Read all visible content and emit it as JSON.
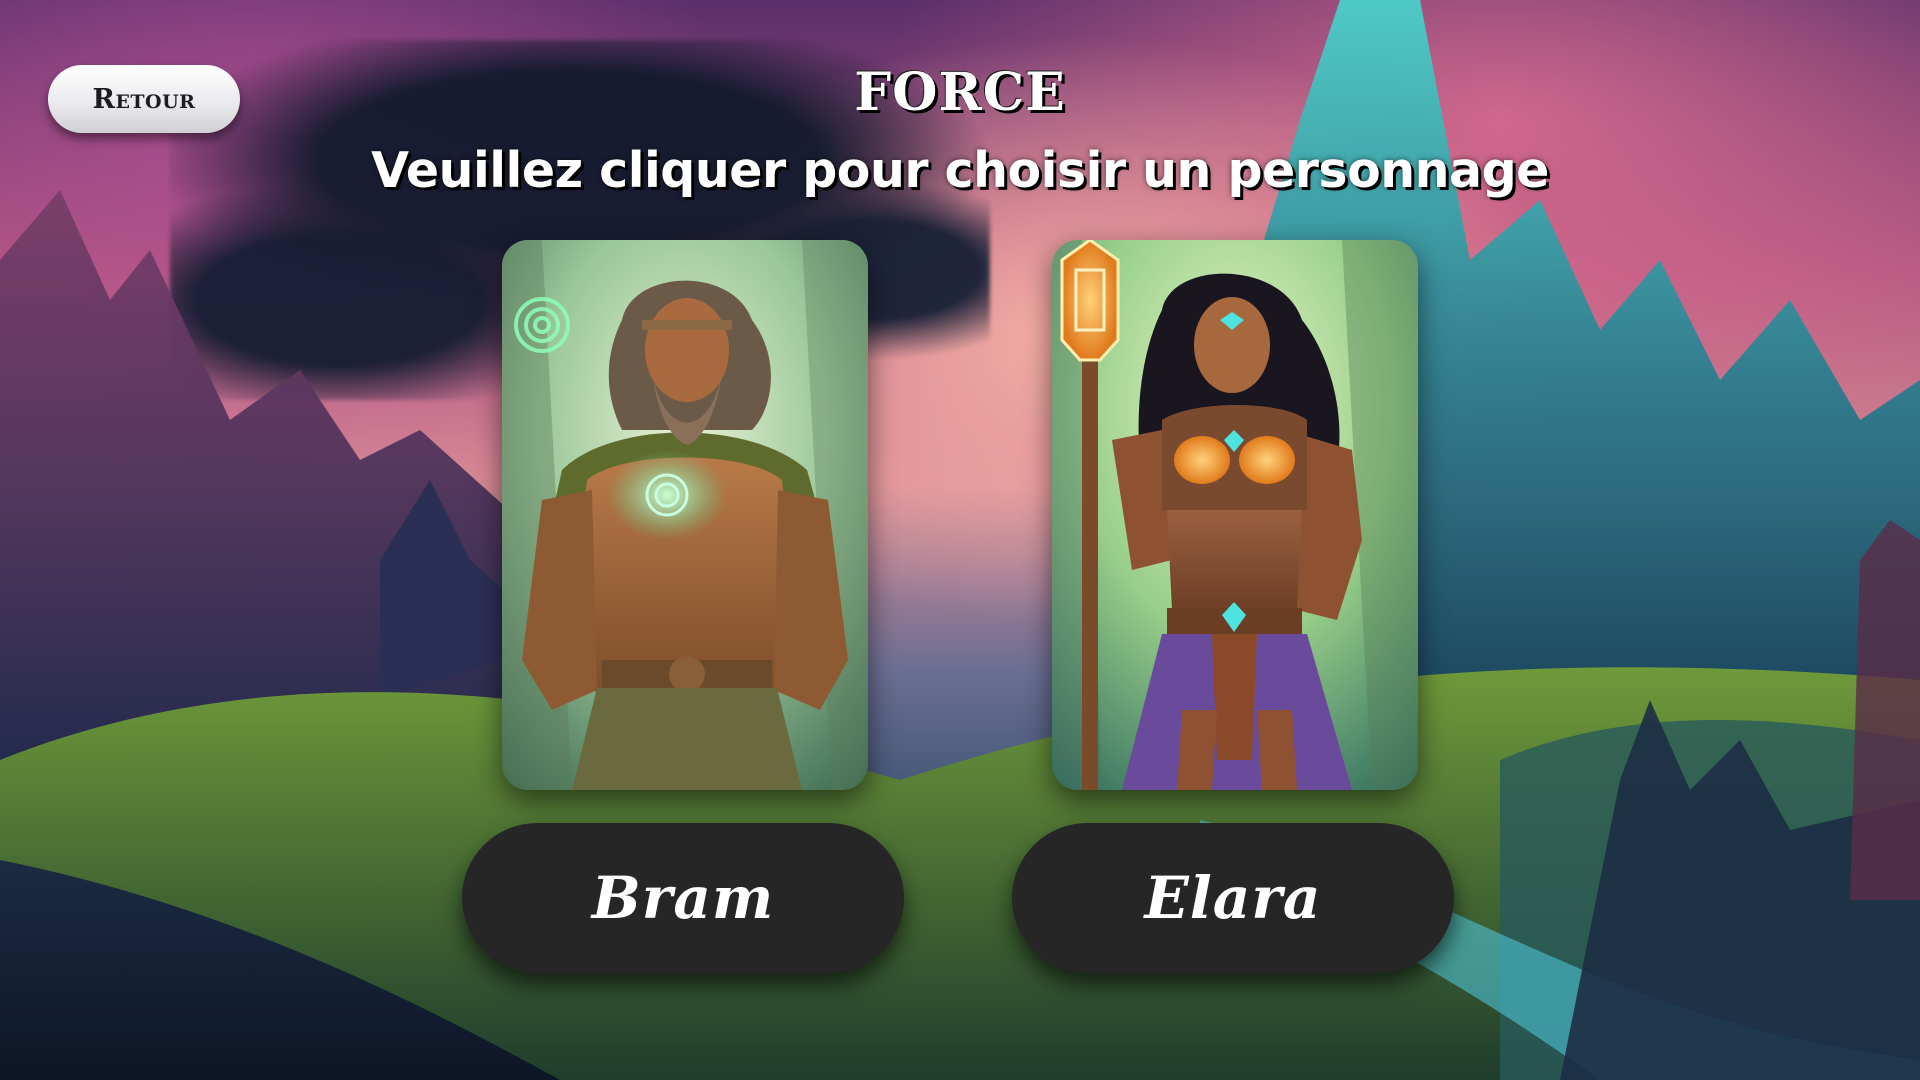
{
  "header": {
    "back_label": "Retour",
    "title": "FORCE",
    "subtitle": "Veuillez cliquer pour choisir un personnage"
  },
  "characters": [
    {
      "name": "Bram",
      "portrait": "earth-druid-warrior-portrait"
    },
    {
      "name": "Elara",
      "portrait": "staff-warrior-woman-portrait"
    }
  ],
  "colors": {
    "button_dark": "#262626",
    "button_light": "#ececef",
    "text": "#ffffff",
    "glow_green": "#8dffb8",
    "glow_cyan": "#4fe3e0",
    "glow_orange": "#ffb04a"
  }
}
